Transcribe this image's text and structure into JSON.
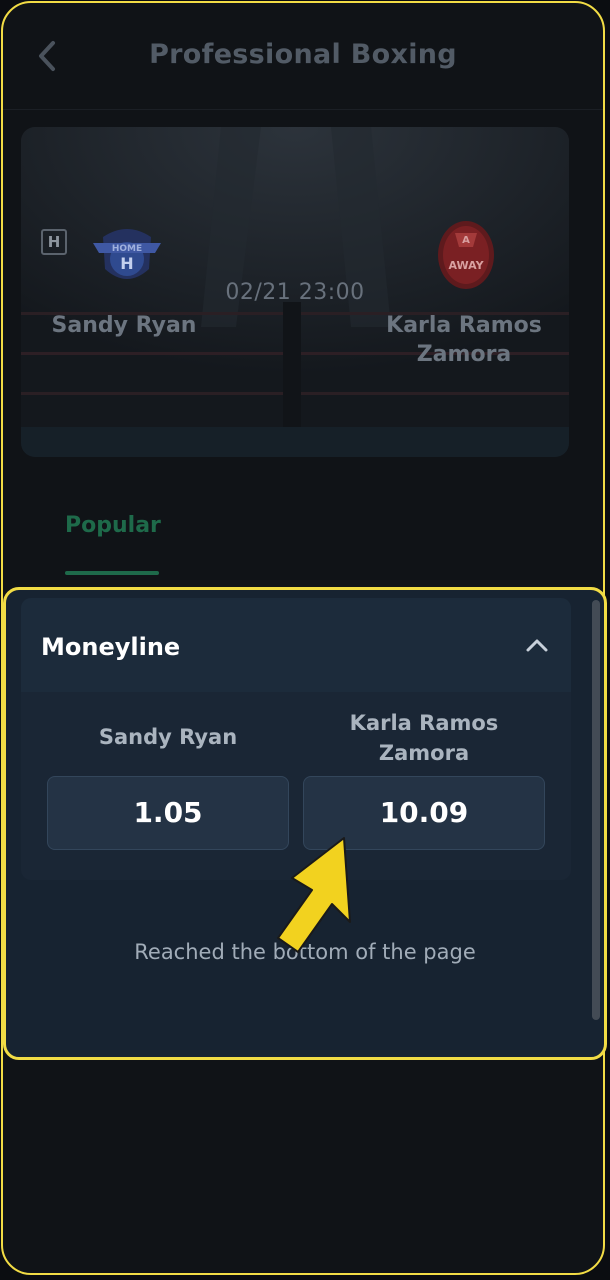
{
  "header": {
    "title": "Professional Boxing",
    "back_icon": "chevron-left-icon"
  },
  "match": {
    "home_badge": "H",
    "home_logo_text": "HOME",
    "home_logo_letter": "H",
    "away_logo_text": "AWAY",
    "away_logo_letter": "A",
    "home_name": "Sandy Ryan",
    "away_name_line1": "Karla Ramos",
    "away_name_line2": "Zamora",
    "time": "02/21 23:00"
  },
  "tabs": {
    "popular": "Popular"
  },
  "moneyline": {
    "title": "Moneyline",
    "collapse_icon": "chevron-up-icon",
    "home": {
      "name": "Sandy Ryan",
      "odds": "1.05"
    },
    "away": {
      "name_line1": "Karla Ramos",
      "name_line2": "Zamora",
      "odds": "10.09"
    }
  },
  "footer_message": "Reached the bottom of the page",
  "colors": {
    "highlight": "#f2dc45",
    "accent_green": "#1e6a4a",
    "panel": "#172331",
    "odds_button": "#243345"
  }
}
